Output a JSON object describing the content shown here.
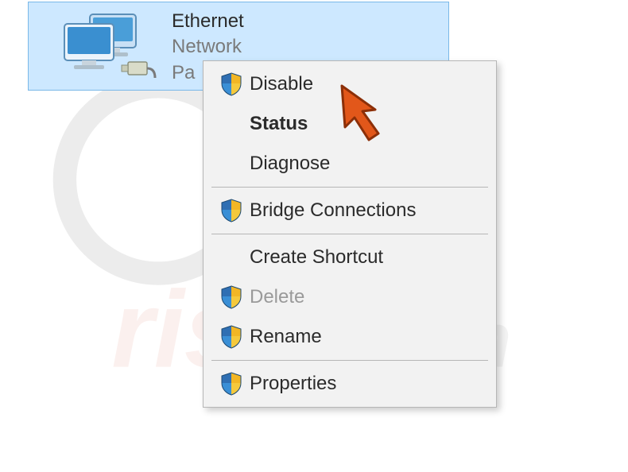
{
  "adapter": {
    "name": "Ethernet",
    "subtitle1": "Network",
    "subtitle2": "Pa"
  },
  "menu": {
    "items": [
      {
        "label": "Disable",
        "shield": true,
        "bold": false,
        "disabled": false
      },
      {
        "label": "Status",
        "shield": false,
        "bold": true,
        "disabled": false
      },
      {
        "label": "Diagnose",
        "shield": false,
        "bold": false,
        "disabled": false
      }
    ],
    "group2": [
      {
        "label": "Bridge Connections",
        "shield": true,
        "bold": false,
        "disabled": false
      }
    ],
    "group3": [
      {
        "label": "Create Shortcut",
        "shield": false,
        "bold": false,
        "disabled": false
      },
      {
        "label": "Delete",
        "shield": true,
        "bold": false,
        "disabled": true
      },
      {
        "label": "Rename",
        "shield": true,
        "bold": false,
        "disabled": false
      }
    ],
    "group4": [
      {
        "label": "Properties",
        "shield": true,
        "bold": false,
        "disabled": false
      }
    ]
  }
}
